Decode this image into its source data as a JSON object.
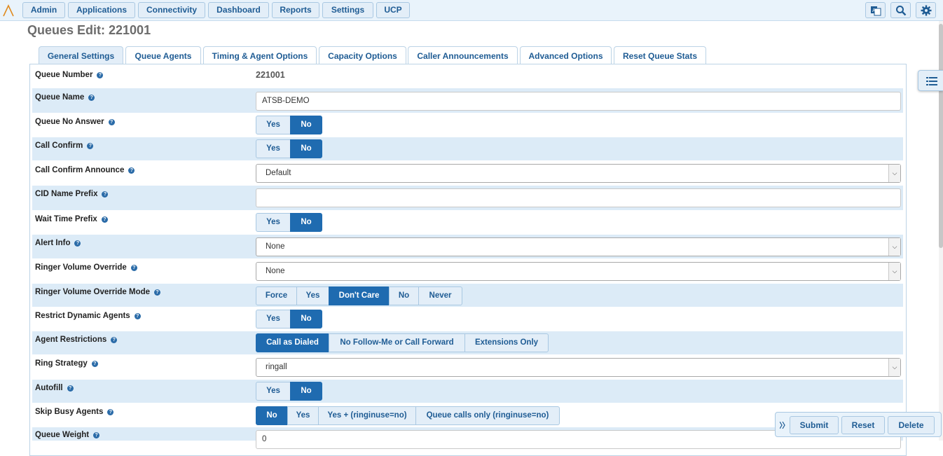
{
  "nav": {
    "items": [
      {
        "label": "Admin"
      },
      {
        "label": "Applications"
      },
      {
        "label": "Connectivity"
      },
      {
        "label": "Dashboard"
      },
      {
        "label": "Reports"
      },
      {
        "label": "Settings"
      },
      {
        "label": "UCP"
      }
    ],
    "icons": [
      "translate-icon",
      "search-icon",
      "gear-icon"
    ]
  },
  "page_title": "Queues Edit: 221001",
  "tabs": [
    {
      "label": "General Settings",
      "active": true
    },
    {
      "label": "Queue Agents"
    },
    {
      "label": "Timing & Agent Options"
    },
    {
      "label": "Capacity Options"
    },
    {
      "label": "Caller Announcements"
    },
    {
      "label": "Advanced Options"
    },
    {
      "label": "Reset Queue Stats"
    }
  ],
  "fields": {
    "queue_number": {
      "label": "Queue Number",
      "value": "221001"
    },
    "queue_name": {
      "label": "Queue Name",
      "value": "ATSB-DEMO"
    },
    "queue_no_answer": {
      "label": "Queue No Answer",
      "options": [
        "Yes",
        "No"
      ],
      "selected": "No"
    },
    "call_confirm": {
      "label": "Call Confirm",
      "options": [
        "Yes",
        "No"
      ],
      "selected": "No"
    },
    "call_confirm_announce": {
      "label": "Call Confirm Announce",
      "value": "Default"
    },
    "cid_name_prefix": {
      "label": "CID Name Prefix",
      "value": ""
    },
    "wait_time_prefix": {
      "label": "Wait Time Prefix",
      "options": [
        "Yes",
        "No"
      ],
      "selected": "No"
    },
    "alert_info": {
      "label": "Alert Info",
      "value": "None"
    },
    "ringer_volume_override": {
      "label": "Ringer Volume Override",
      "value": "None"
    },
    "ringer_volume_override_mode": {
      "label": "Ringer Volume Override Mode",
      "options": [
        "Force",
        "Yes",
        "Don't Care",
        "No",
        "Never"
      ],
      "selected": "Don't Care"
    },
    "restrict_dynamic_agents": {
      "label": "Restrict Dynamic Agents",
      "options": [
        "Yes",
        "No"
      ],
      "selected": "No"
    },
    "agent_restrictions": {
      "label": "Agent Restrictions",
      "options": [
        "Call as Dialed",
        "No Follow-Me or Call Forward",
        "Extensions Only"
      ],
      "selected": "Call as Dialed"
    },
    "ring_strategy": {
      "label": "Ring Strategy",
      "value": "ringall"
    },
    "autofill": {
      "label": "Autofill",
      "options": [
        "Yes",
        "No"
      ],
      "selected": "No"
    },
    "skip_busy_agents": {
      "label": "Skip Busy Agents",
      "options": [
        "No",
        "Yes",
        "Yes + (ringinuse=no)",
        "Queue calls only (ringinuse=no)"
      ],
      "selected": "No"
    },
    "queue_weight": {
      "label": "Queue Weight",
      "value": "0"
    }
  },
  "actions": {
    "submit": "Submit",
    "reset": "Reset",
    "delete": "Delete"
  },
  "colors": {
    "accent": "#1f6bb0",
    "row_alt": "#dcebf7",
    "button_bg": "#e3eef8",
    "link_text": "#1f5c94"
  }
}
